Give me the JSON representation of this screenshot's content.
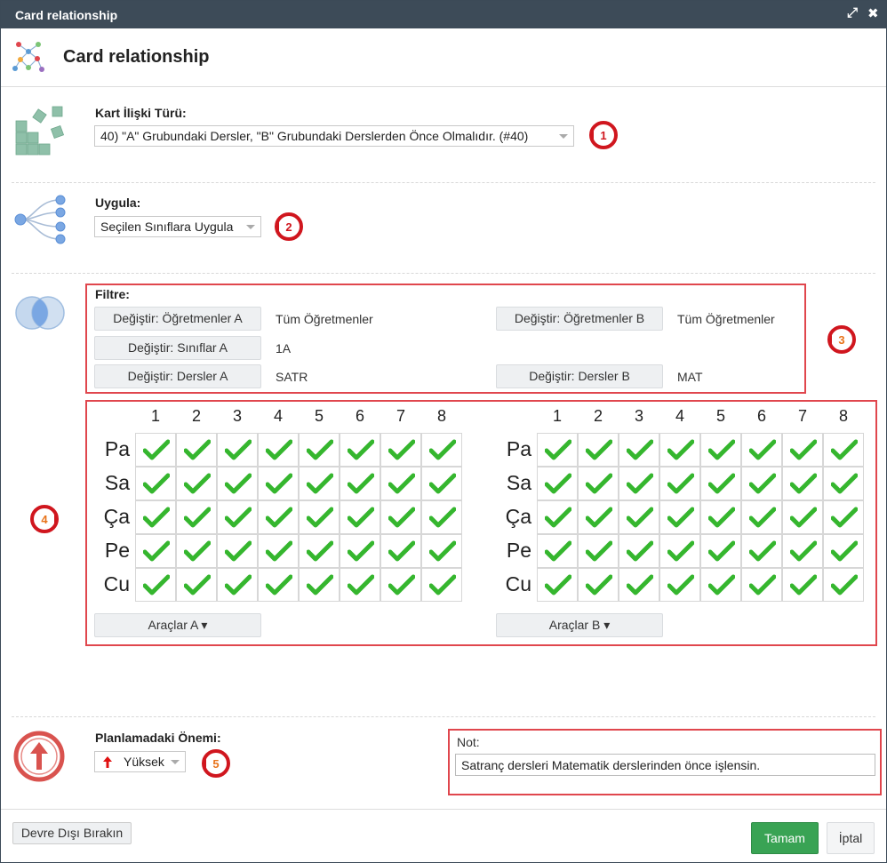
{
  "window": {
    "title": "Card relationship"
  },
  "header": {
    "title": "Card relationship",
    "icon": "relationship-network-icon"
  },
  "relation_type": {
    "label": "Kart İlişki Türü:",
    "value": "40) \"A\" Grubundaki Dersler, \"B\" Grubundaki Derslerden Önce Olmalıdır. (#40)"
  },
  "apply": {
    "label": "Uygula:",
    "value": "Seçilen Sınıflara Uygula"
  },
  "filter": {
    "label": "Filtre:",
    "teachers_a_btn": "Değiştir: Öğretmenler A",
    "teachers_a_val": "Tüm Öğretmenler",
    "teachers_b_btn": "Değiştir: Öğretmenler B",
    "teachers_b_val": "Tüm Öğretmenler",
    "classes_a_btn": "Değiştir: Sınıflar A",
    "classes_a_val": "1A",
    "subjects_a_btn": "Değiştir: Dersler A",
    "subjects_a_val": "SATR",
    "subjects_b_btn": "Değiştir: Dersler B",
    "subjects_b_val": "MAT"
  },
  "grid": {
    "periods": [
      "1",
      "2",
      "3",
      "4",
      "5",
      "6",
      "7",
      "8"
    ],
    "days": [
      "Pa",
      "Sa",
      "Ça",
      "Pe",
      "Cu"
    ],
    "all_checked": true,
    "tools_a": "Araçlar A ▾",
    "tools_b": "Araçlar B ▾"
  },
  "importance": {
    "label": "Planlamadaki Önemi:",
    "value": "Yüksek"
  },
  "note": {
    "label": "Not:",
    "value": "Satranç dersleri Matematik derslerinden önce işlensin."
  },
  "callouts": [
    "1",
    "2",
    "3",
    "4",
    "5"
  ],
  "footer": {
    "disable": "Devre Dışı Bırakın",
    "ok": "Tamam",
    "cancel": "İptal"
  },
  "colors": {
    "titlebar": "#3d4b58",
    "callout_red": "#d0161e",
    "box_red": "#e0464d",
    "check_green": "#35b62e",
    "ok_green": "#39a354"
  }
}
